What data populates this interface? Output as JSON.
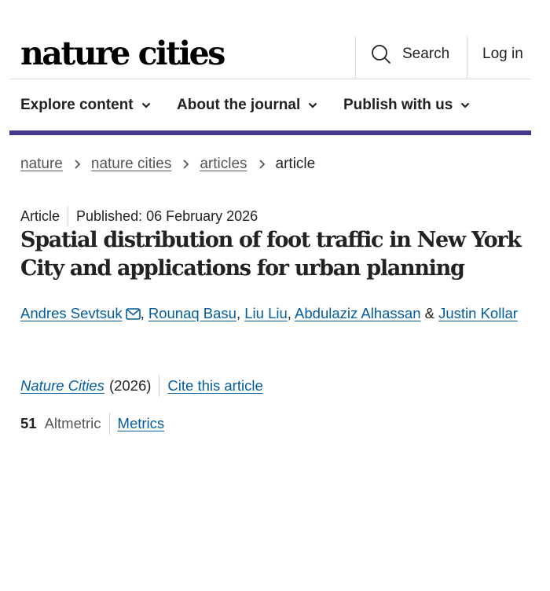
{
  "header": {
    "logo_text": "nature cities",
    "search_label": "Search",
    "search_icon": "search-icon",
    "login_label": "Log in"
  },
  "nav": {
    "items": [
      {
        "label": "Explore content",
        "icon": "chevron-down-icon"
      },
      {
        "label": "About the journal",
        "icon": "chevron-down-icon"
      },
      {
        "label": "Publish with us",
        "icon": "chevron-down-icon"
      }
    ],
    "accent_color": "#453b8c"
  },
  "breadcrumb": {
    "items": [
      "nature",
      "nature cities",
      "articles"
    ],
    "current": "article",
    "separator_icon": "chevron-right-icon"
  },
  "article": {
    "type": "Article",
    "published": "Published: 06 February 2026",
    "title": "Spatial distribution of foot traffic in New York City and applications for urban planning",
    "authors": [
      "Andres Sevtsuk",
      "Rounaq Basu",
      "Liu Liu",
      "Abdulaziz Alhassan",
      "Justin Kollar"
    ],
    "author_separator": ",",
    "author_last_separator": "&",
    "contact_icon": "mail-icon",
    "journal": "Nature Cities",
    "year": "(2026)",
    "cite_label": "Cite this article",
    "altmetric_count": "51",
    "altmetric_label": "Altmetric",
    "metrics_label": "Metrics",
    "link_color": "#025c9e"
  }
}
